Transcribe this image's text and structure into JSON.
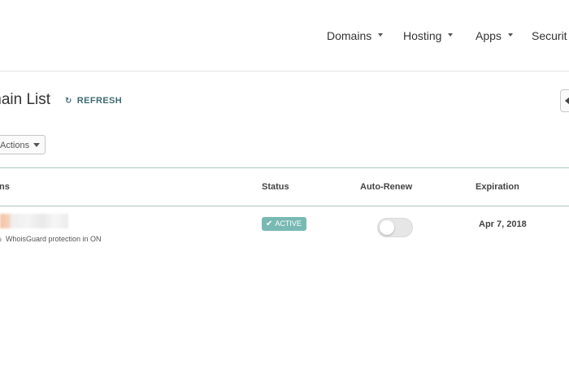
{
  "nav": {
    "items": [
      {
        "label": "Domains"
      },
      {
        "label": "Hosting"
      },
      {
        "label": "Apps"
      },
      {
        "label": "Securit"
      }
    ]
  },
  "page": {
    "title": "main List",
    "refresh_label": "REFRESH"
  },
  "toolbar": {
    "actions_label": "Actions"
  },
  "table": {
    "columns": [
      "ins",
      "Status",
      "Auto-Renew",
      "Expiration"
    ],
    "rows": [
      {
        "domain": "",
        "whois_note": "WhoisGuard protection in ON",
        "status": "ACTIVE",
        "auto_renew": false,
        "expiration": "Apr 7, 2018"
      }
    ]
  },
  "colors": {
    "status_active": "#79b9b3",
    "accent": "#3d6b73",
    "header_border": "#a9c7c3"
  }
}
